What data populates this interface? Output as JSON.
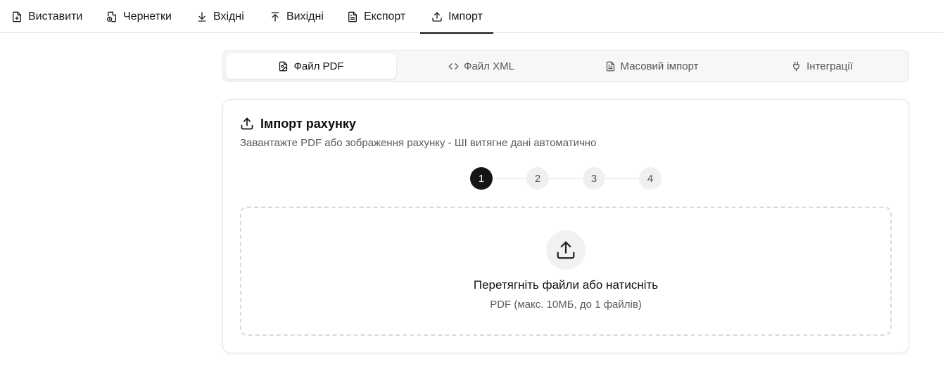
{
  "nav": {
    "tabs": [
      {
        "label": "Виставити",
        "icon": "file-plus-icon"
      },
      {
        "label": "Чернетки",
        "icon": "draft-icon"
      },
      {
        "label": "Вхідні",
        "icon": "download-icon"
      },
      {
        "label": "Вихідні",
        "icon": "upload-icon"
      },
      {
        "label": "Експорт",
        "icon": "file-text-icon"
      },
      {
        "label": "Імпорт",
        "icon": "import-icon"
      }
    ],
    "active_index": 5
  },
  "subtabs": {
    "items": [
      {
        "label": "Файл PDF",
        "icon": "file-image-icon"
      },
      {
        "label": "Файл XML",
        "icon": "code-icon"
      },
      {
        "label": "Масовий імпорт",
        "icon": "file-text-icon"
      },
      {
        "label": "Інтеграції",
        "icon": "plug-icon"
      }
    ],
    "active_index": 0
  },
  "card": {
    "title": "Імпорт рахунку",
    "subtitle": "Завантажте PDF або зображення рахунку - ШІ витягне дані автоматично",
    "steps": [
      "1",
      "2",
      "3",
      "4"
    ],
    "active_step": 0,
    "dropzone": {
      "title": "Перетягніть файли або натисніть",
      "hint": "PDF (макс. 10МБ, до 1 файлів)"
    }
  },
  "colors": {
    "accent": "#111111",
    "muted_text": "#5a5a5a",
    "border": "#e6e6e6",
    "subtle_bg": "#f7f7f7"
  }
}
